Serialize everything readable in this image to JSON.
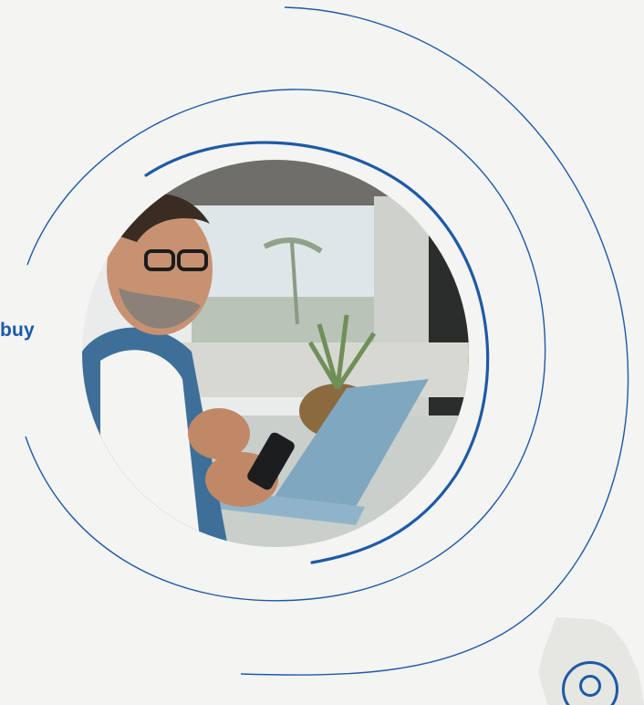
{
  "side_text": {
    "label": "buy"
  },
  "photo": {
    "description_icon": "person-using-phone-and-laptop-photo"
  },
  "decor": {
    "rings_icon": "concentric-arc-lines",
    "map_icon": "region-map-silhouette",
    "location_icon": "location-target-icon"
  },
  "colors": {
    "accent": "#1d5aa6",
    "background": "#f4f4f2",
    "map_fill": "#e6e6e3"
  }
}
